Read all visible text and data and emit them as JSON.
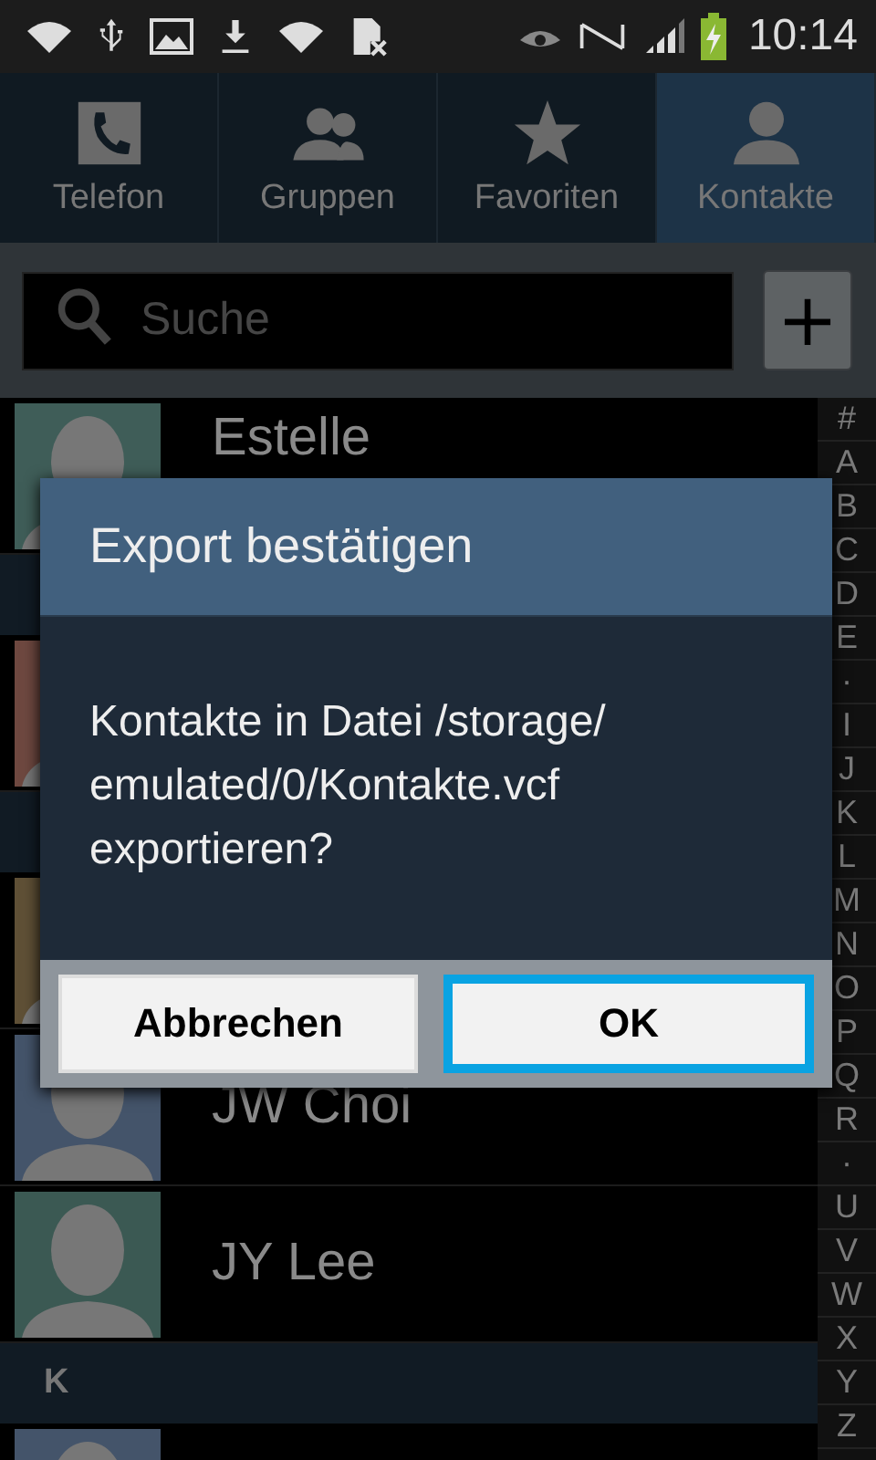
{
  "status_bar": {
    "time": "10:14"
  },
  "tabs": [
    {
      "label": "Telefon",
      "selected": false
    },
    {
      "label": "Gruppen",
      "selected": false
    },
    {
      "label": "Favoriten",
      "selected": false
    },
    {
      "label": "Kontakte",
      "selected": true
    }
  ],
  "search": {
    "placeholder": "Suche",
    "add_button": "+"
  },
  "list": [
    {
      "kind": "contact",
      "name": "Estelle",
      "color": "#3f5d58"
    },
    {
      "kind": "header"
    },
    {
      "kind": "contact",
      "color": "#6e4840"
    },
    {
      "kind": "header"
    },
    {
      "kind": "contact",
      "color": "#5f5036"
    },
    {
      "kind": "contact",
      "name": "JW Choi",
      "color": "#44546a"
    },
    {
      "kind": "contact",
      "name": "JY Lee",
      "color": "#3b5953"
    },
    {
      "kind": "header",
      "letter": "K"
    },
    {
      "kind": "contact",
      "color": "#44546a"
    }
  ],
  "index": [
    "#",
    "A",
    "B",
    "C",
    "D",
    "E",
    "·",
    "I",
    "J",
    "K",
    "L",
    "M",
    "N",
    "O",
    "P",
    "Q",
    "R",
    "·",
    "U",
    "V",
    "W",
    "X",
    "Y",
    "Z"
  ],
  "dialog": {
    "title": "Export bestätigen",
    "message": "Kontakte in Datei /storage/ emulated/0/Kontakte.vcf exportieren?",
    "buttons": [
      {
        "label": "Abbrechen",
        "selected": false
      },
      {
        "label": "OK",
        "selected": true
      }
    ]
  }
}
